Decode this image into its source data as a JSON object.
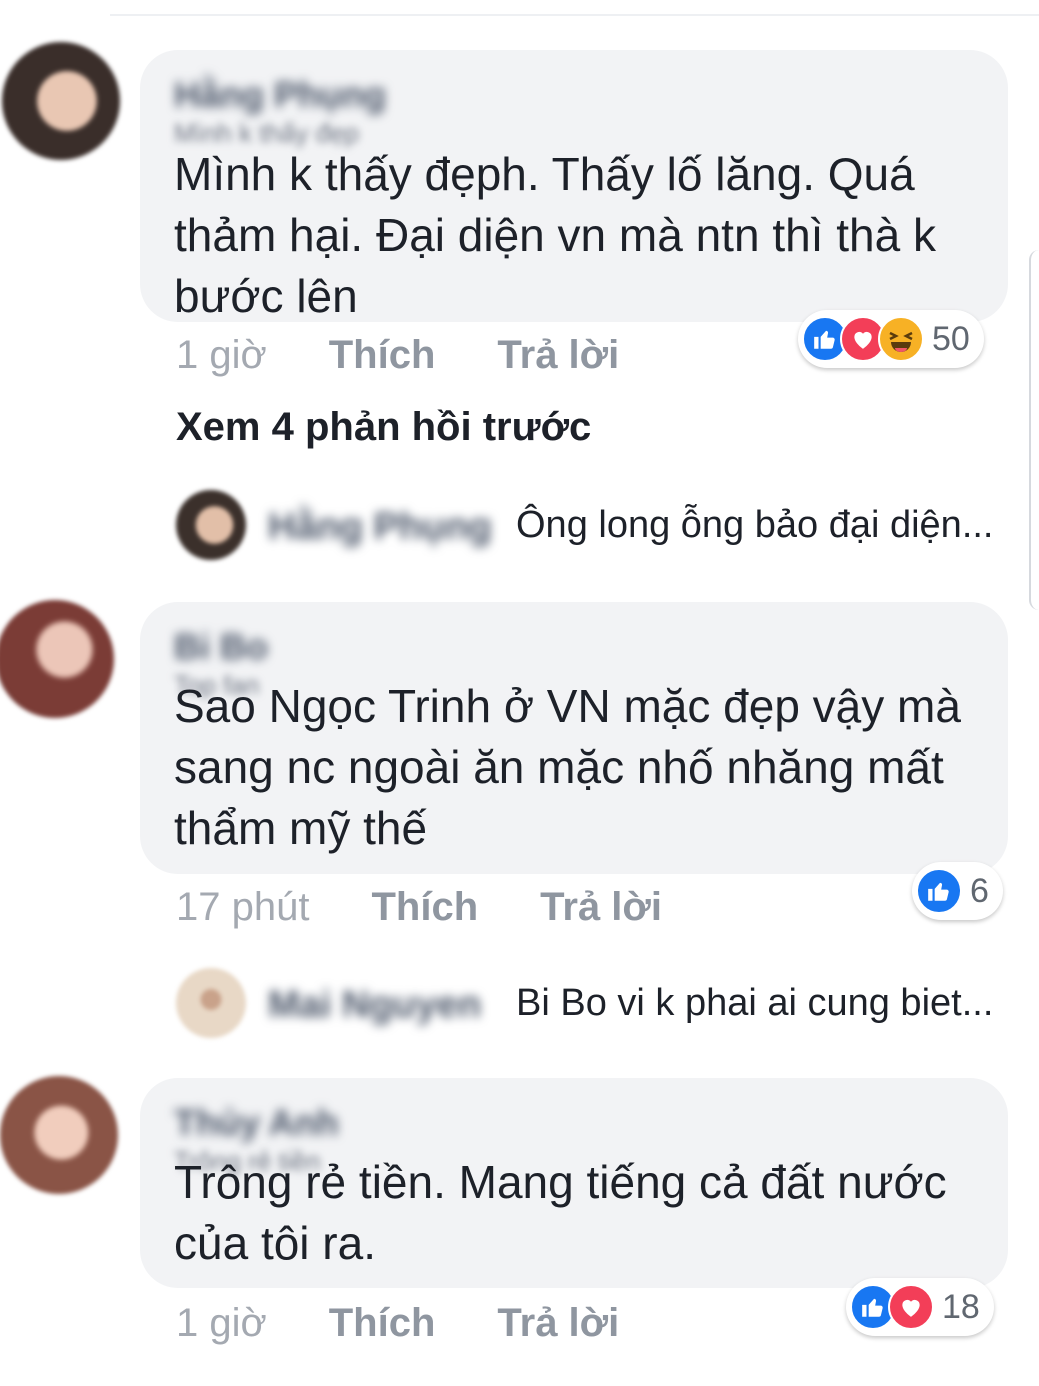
{
  "comments": [
    {
      "author": "Hằng Phụng",
      "author_sub": "Mình k thấy đẹp",
      "text": "Mình k thấy đẹph. Thấy lố lăng. Quá thảm hại. Đại diện vn mà ntn thì thà k bước lên",
      "time": "1 giờ",
      "like_label": "Thích",
      "reply_label": "Trả lời",
      "reactions": [
        "like",
        "love",
        "haha"
      ],
      "reaction_count": "50"
    },
    {
      "author": "Bi Bo",
      "author_sub": "Top fan",
      "text": "Sao Ngọc Trinh ở VN mặc đẹp vậy mà sang nc ngoài ăn mặc nhố nhăng mất thẩm mỹ thế",
      "time": "17 phút",
      "like_label": "Thích",
      "reply_label": "Trả lời",
      "reactions": [
        "like"
      ],
      "reaction_count": "6"
    },
    {
      "author": "Thủy Anh",
      "author_sub": "Trông rẻ tiền",
      "text": "Trông rẻ tiền. Mang tiếng cả đất nước của tôi ra.",
      "time": "1 giờ",
      "like_label": "Thích",
      "reply_label": "Trả lời",
      "reactions": [
        "like",
        "love"
      ],
      "reaction_count": "18"
    }
  ],
  "more_replies": "Xem 4 phản hồi trước",
  "replies": [
    {
      "author": "Hằng Phụng",
      "text": "Ông long ỗng bảo đại diện..."
    },
    {
      "author": "Mai Nguyen",
      "text": "Bi Bo  vi k phai ai cung biet..."
    }
  ],
  "icons": {
    "like": "thumbs-up-icon",
    "love": "heart-icon",
    "haha": "laughing-face-icon"
  },
  "colors": {
    "like": "#1877f2",
    "love": "#f33e58",
    "haha": "#f7b125",
    "bubble": "#f2f3f5"
  }
}
